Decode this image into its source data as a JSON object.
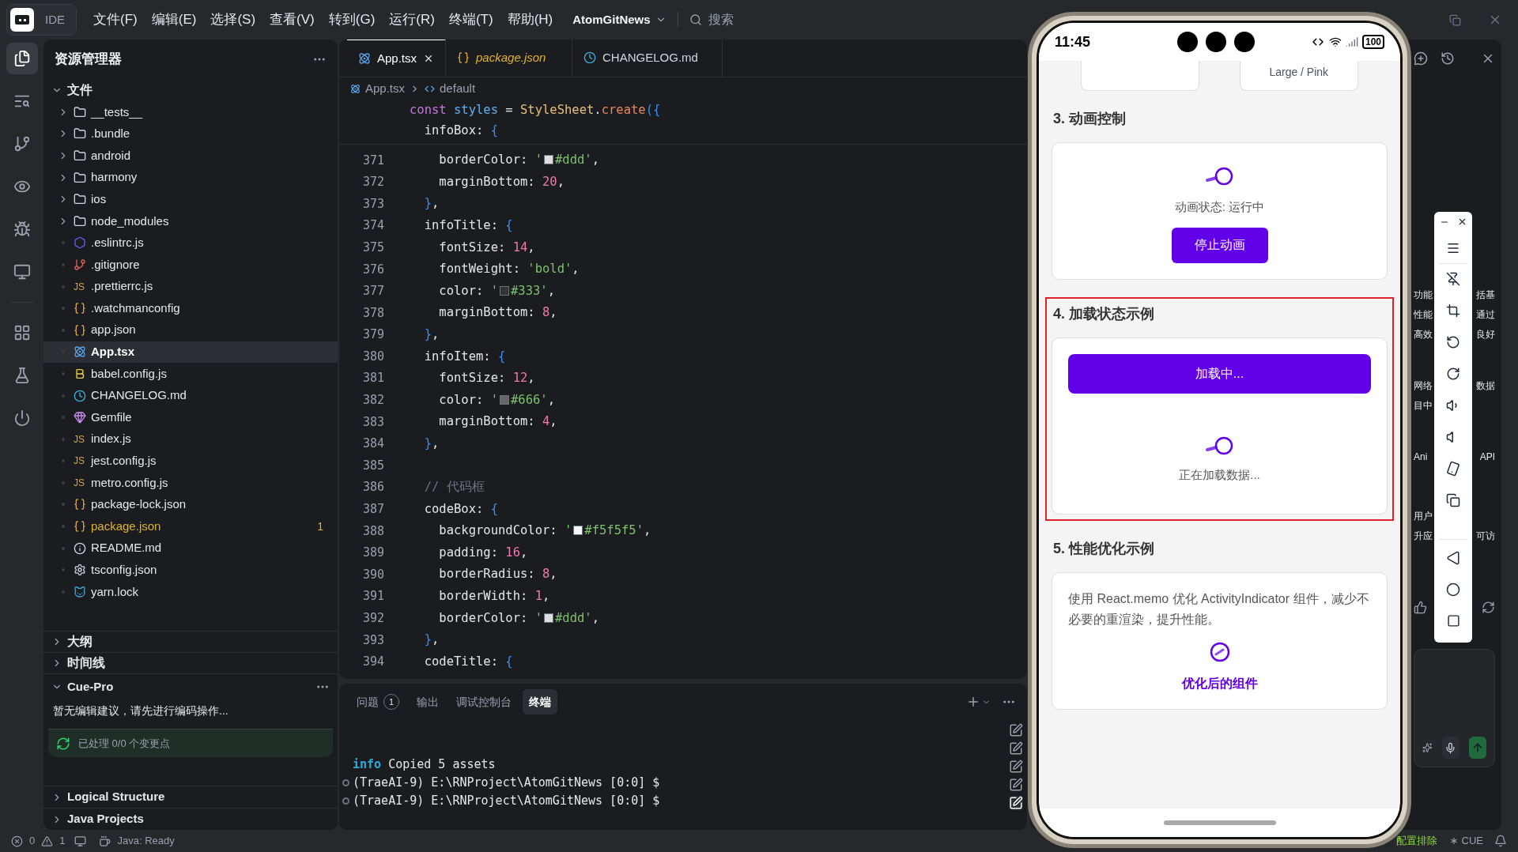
{
  "title_bar": {
    "product": "IDE",
    "menus": [
      "文件(F)",
      "编辑(E)",
      "选择(S)",
      "查看(V)",
      "转到(G)",
      "运行(R)",
      "终端(T)",
      "帮助(H)"
    ],
    "project": "AtomGitNews",
    "search": {
      "placeholder": "搜索"
    }
  },
  "activity_bar": [
    {
      "selected": true
    },
    {
      "selected": false
    },
    {
      "selected": false
    },
    {
      "selected": false
    },
    {
      "selected": false
    },
    {
      "selected": false
    },
    {
      "selected": false
    },
    {
      "selected": false
    },
    {
      "selected": false
    }
  ],
  "explorer": {
    "title": "资源管理器",
    "root": {
      "label": "文件",
      "expanded": true,
      "children": [
        {
          "name": "__tests__",
          "kind": "folder",
          "expanded": false,
          "selected": false,
          "modified": false
        },
        {
          "name": ".bundle",
          "kind": "folder",
          "expanded": false,
          "selected": false,
          "modified": false
        },
        {
          "name": "android",
          "kind": "folder",
          "expanded": false,
          "selected": false,
          "modified": false
        },
        {
          "name": "harmony",
          "kind": "folder",
          "expanded": false,
          "selected": false,
          "modified": false
        },
        {
          "name": "ios",
          "kind": "folder",
          "expanded": false,
          "selected": false,
          "modified": false
        },
        {
          "name": "node_modules",
          "kind": "folder",
          "expanded": false,
          "selected": false,
          "modified": false
        },
        {
          "name": ".eslintrc.js",
          "kind": "eslint",
          "selected": false,
          "modified": false
        },
        {
          "name": ".gitignore",
          "kind": "git",
          "selected": false,
          "modified": false
        },
        {
          "name": ".prettierrc.js",
          "kind": "js",
          "icon_text": "JS",
          "selected": false,
          "modified": false
        },
        {
          "name": ".watchmanconfig",
          "kind": "json",
          "selected": false,
          "modified": false
        },
        {
          "name": "app.json",
          "kind": "json",
          "selected": false,
          "modified": false
        },
        {
          "name": "App.tsx",
          "kind": "react",
          "selected": true,
          "modified": false
        },
        {
          "name": "babel.config.js",
          "kind": "babel",
          "selected": false,
          "modified": false
        },
        {
          "name": "CHANGELOG.md",
          "kind": "clock",
          "selected": false,
          "modified": false
        },
        {
          "name": "Gemfile",
          "kind": "gem",
          "selected": false,
          "modified": false
        },
        {
          "name": "index.js",
          "kind": "js",
          "icon_text": "JS",
          "selected": false,
          "modified": false
        },
        {
          "name": "jest.config.js",
          "kind": "js",
          "icon_text": "JS",
          "selected": false,
          "modified": false
        },
        {
          "name": "metro.config.js",
          "kind": "js",
          "icon_text": "JS",
          "selected": false,
          "modified": false
        },
        {
          "name": "package-lock.json",
          "kind": "json",
          "selected": false,
          "modified": false
        },
        {
          "name": "package.json",
          "kind": "json",
          "selected": false,
          "modified": true,
          "count": "1"
        },
        {
          "name": "README.md",
          "kind": "info",
          "selected": false,
          "modified": false
        },
        {
          "name": "tsconfig.json",
          "kind": "gear",
          "selected": false,
          "modified": false
        },
        {
          "name": "yarn.lock",
          "kind": "yarn",
          "selected": false,
          "modified": false
        }
      ]
    }
  },
  "sections": [
    {
      "label": "大纲",
      "expanded": false
    },
    {
      "label": "时间线",
      "expanded": false
    }
  ],
  "cue_pro": {
    "label": "Cue-Pro",
    "expanded": true,
    "message": "暂无编辑建议，请先进行编码操作...",
    "status": "已处理 0/0 个变更点"
  },
  "bottom_sections": [
    {
      "label": "Logical Structure",
      "expanded": false
    },
    {
      "label": "Java Projects",
      "expanded": false
    }
  ],
  "editor": {
    "tabs": [
      {
        "label": "App.tsx",
        "kind": "react",
        "selected": true,
        "modified": false
      },
      {
        "label": "package.json",
        "kind": "json",
        "selected": false,
        "modified": true
      },
      {
        "label": "CHANGELOG.md",
        "kind": "clock",
        "selected": false,
        "modified": false
      }
    ],
    "breadcrumb": [
      "App.tsx",
      "default"
    ],
    "sticky": [
      [
        {
          "kind": "kw",
          "t": "const"
        },
        {
          "kind": "var",
          "t": " styles"
        },
        {
          "kind": "p",
          "t": " = "
        },
        {
          "kind": "fn",
          "t": "StyleSheet"
        },
        {
          "kind": "p",
          "t": "."
        },
        {
          "kind": "method",
          "t": "create"
        },
        {
          "kind": "brace",
          "t": "({"
        }
      ],
      [
        {
          "kind": "p",
          "t": "  infoBox: "
        },
        {
          "kind": "brace",
          "t": "{"
        }
      ]
    ],
    "lines": [
      {
        "n": "371",
        "tokens": [
          {
            "kind": "p",
            "t": "    borderColor: "
          },
          {
            "kind": "str",
            "t": "'"
          },
          {
            "kind": "swatch",
            "color": "#dddddd"
          },
          {
            "kind": "str",
            "t": "#ddd'"
          },
          {
            "kind": "p",
            "t": ","
          }
        ]
      },
      {
        "n": "372",
        "tokens": [
          {
            "kind": "p",
            "t": "    marginBottom: "
          },
          {
            "kind": "num",
            "t": "20"
          },
          {
            "kind": "p",
            "t": ","
          }
        ]
      },
      {
        "n": "373",
        "tokens": [
          {
            "kind": "brace",
            "t": "  }"
          },
          {
            "kind": "p",
            "t": ","
          }
        ]
      },
      {
        "n": "374",
        "tokens": [
          {
            "kind": "p",
            "t": "  infoTitle: "
          },
          {
            "kind": "brace",
            "t": "{"
          }
        ]
      },
      {
        "n": "375",
        "tokens": [
          {
            "kind": "p",
            "t": "    fontSize: "
          },
          {
            "kind": "num",
            "t": "14"
          },
          {
            "kind": "p",
            "t": ","
          }
        ]
      },
      {
        "n": "376",
        "tokens": [
          {
            "kind": "p",
            "t": "    fontWeight: "
          },
          {
            "kind": "str",
            "t": "'bold'"
          },
          {
            "kind": "p",
            "t": ","
          }
        ]
      },
      {
        "n": "377",
        "tokens": [
          {
            "kind": "p",
            "t": "    color: "
          },
          {
            "kind": "str",
            "t": "'"
          },
          {
            "kind": "swatch",
            "color": "#333333"
          },
          {
            "kind": "str",
            "t": "#333'"
          },
          {
            "kind": "p",
            "t": ","
          }
        ]
      },
      {
        "n": "378",
        "tokens": [
          {
            "kind": "p",
            "t": "    marginBottom: "
          },
          {
            "kind": "num",
            "t": "8"
          },
          {
            "kind": "p",
            "t": ","
          }
        ]
      },
      {
        "n": "379",
        "tokens": [
          {
            "kind": "brace",
            "t": "  }"
          },
          {
            "kind": "p",
            "t": ","
          }
        ]
      },
      {
        "n": "380",
        "tokens": [
          {
            "kind": "p",
            "t": "  infoItem: "
          },
          {
            "kind": "brace",
            "t": "{"
          }
        ]
      },
      {
        "n": "381",
        "tokens": [
          {
            "kind": "p",
            "t": "    fontSize: "
          },
          {
            "kind": "num",
            "t": "12"
          },
          {
            "kind": "p",
            "t": ","
          }
        ]
      },
      {
        "n": "382",
        "tokens": [
          {
            "kind": "p",
            "t": "    color: "
          },
          {
            "kind": "str",
            "t": "'"
          },
          {
            "kind": "swatch",
            "color": "#666666"
          },
          {
            "kind": "str",
            "t": "#666'"
          },
          {
            "kind": "p",
            "t": ","
          }
        ]
      },
      {
        "n": "383",
        "tokens": [
          {
            "kind": "p",
            "t": "    marginBottom: "
          },
          {
            "kind": "num",
            "t": "4"
          },
          {
            "kind": "p",
            "t": ","
          }
        ]
      },
      {
        "n": "384",
        "tokens": [
          {
            "kind": "brace",
            "t": "  }"
          },
          {
            "kind": "p",
            "t": ","
          }
        ]
      },
      {
        "n": "385"
      },
      {
        "n": "386",
        "tokens": [
          {
            "kind": "comment",
            "t": "  // 代码框"
          }
        ]
      },
      {
        "n": "387",
        "tokens": [
          {
            "kind": "p",
            "t": "  codeBox: "
          },
          {
            "kind": "brace",
            "t": "{"
          }
        ]
      },
      {
        "n": "388",
        "tokens": [
          {
            "kind": "p",
            "t": "    backgroundColor: "
          },
          {
            "kind": "str",
            "t": "'"
          },
          {
            "kind": "swatch",
            "color": "#f5f5f5"
          },
          {
            "kind": "str",
            "t": "#f5f5f5'"
          },
          {
            "kind": "p",
            "t": ","
          }
        ]
      },
      {
        "n": "389",
        "tokens": [
          {
            "kind": "p",
            "t": "    padding: "
          },
          {
            "kind": "num",
            "t": "16"
          },
          {
            "kind": "p",
            "t": ","
          }
        ]
      },
      {
        "n": "390",
        "tokens": [
          {
            "kind": "p",
            "t": "    borderRadius: "
          },
          {
            "kind": "num",
            "t": "8"
          },
          {
            "kind": "p",
            "t": ","
          }
        ]
      },
      {
        "n": "391",
        "tokens": [
          {
            "kind": "p",
            "t": "    borderWidth: "
          },
          {
            "kind": "num",
            "t": "1"
          },
          {
            "kind": "p",
            "t": ","
          }
        ]
      },
      {
        "n": "392",
        "tokens": [
          {
            "kind": "p",
            "t": "    borderColor: "
          },
          {
            "kind": "str",
            "t": "'"
          },
          {
            "kind": "swatch",
            "color": "#dddddd"
          },
          {
            "kind": "str",
            "t": "#ddd'"
          },
          {
            "kind": "p",
            "t": ","
          }
        ]
      },
      {
        "n": "393",
        "tokens": [
          {
            "kind": "brace",
            "t": "  }"
          },
          {
            "kind": "p",
            "t": ","
          }
        ]
      },
      {
        "n": "394",
        "tokens": [
          {
            "kind": "p",
            "t": "  codeTitle: "
          },
          {
            "kind": "brace",
            "t": "{"
          }
        ]
      }
    ]
  },
  "panel": {
    "tabs": [
      {
        "label": "问题",
        "count": "1",
        "selected": false
      },
      {
        "label": "输出",
        "selected": false
      },
      {
        "label": "调试控制台",
        "selected": false
      },
      {
        "label": "终端",
        "selected": true
      }
    ],
    "terminal": [
      {
        "kind": "info",
        "tag": "info",
        "text": "Copied 5 assets"
      },
      {
        "kind": "prompt",
        "text": "(TraeAI-9) E:\\RNProject\\AtomGitNews [0:0] $"
      },
      {
        "kind": "prompt",
        "text": "(TraeAI-9) E:\\RNProject\\AtomGitNews [0:0] $"
      }
    ],
    "side_icons": [
      {
        "selected": false
      },
      {
        "selected": false
      },
      {
        "selected": false
      },
      {
        "selected": false
      },
      {
        "selected": true
      }
    ]
  },
  "ai_panel": {
    "fragments": [
      {
        "left": "功能",
        "right": "括基"
      },
      {
        "left": "性能",
        "right": "通过"
      },
      {
        "left": "高效",
        "right": "良好"
      },
      {
        "left": "网络",
        "right": "数据"
      },
      {
        "left": "目中"
      },
      {
        "left": "Ani",
        "right": "API"
      },
      {
        "left": "用户"
      },
      {
        "left": "升应",
        "right": "可访"
      }
    ]
  },
  "phone": {
    "time": "11:45",
    "battery": "100",
    "top_cards": [
      {
        "kind": "blank"
      },
      {
        "kind": "labeled",
        "label": "Large / Pink"
      }
    ],
    "sections": [
      {
        "kind": "animation",
        "title": "3. 动画控制",
        "highlighted": false,
        "status": "动画状态: 运行中",
        "button": "停止动画"
      },
      {
        "kind": "loading",
        "title": "4. 加载状态示例",
        "highlighted": true,
        "button": "加载中...",
        "status": "正在加载数据..."
      },
      {
        "kind": "memo",
        "title": "5. 性能优化示例",
        "highlighted": false,
        "description": "使用 React.memo 优化 ActivityIndicator 组件，减少不必要的重渲染，提升性能。",
        "caption": "优化后的组件"
      }
    ]
  },
  "status_bar": {
    "errors": "0",
    "warnings": "1",
    "java": "Java: Ready",
    "exclude": "配置排除",
    "cue": "CUE"
  }
}
